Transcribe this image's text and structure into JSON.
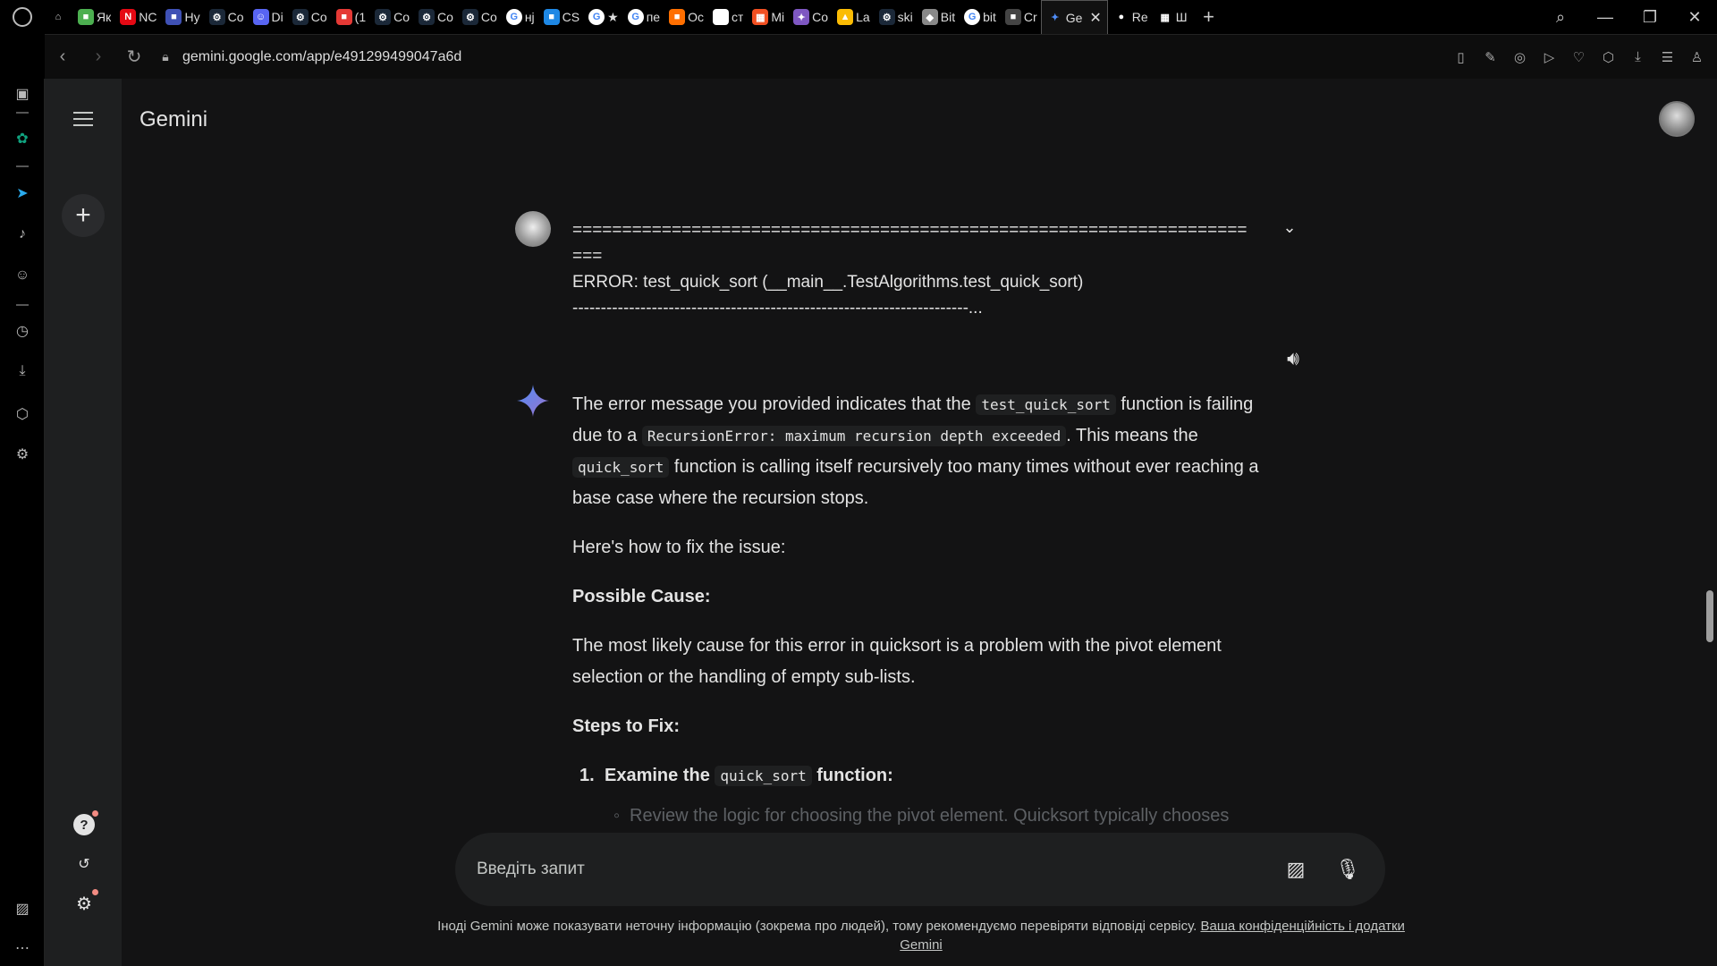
{
  "browser": {
    "tabs": [
      {
        "label": "Як",
        "icon": "app-icon",
        "color": "#4caf50"
      },
      {
        "label": "NC",
        "icon": "netflix-icon",
        "color": "#e50914"
      },
      {
        "label": "Hy",
        "icon": "app-icon",
        "color": "#3f51b5"
      },
      {
        "label": "Co",
        "icon": "steam-icon",
        "color": "#1b2838"
      },
      {
        "label": "Di",
        "icon": "discord-icon",
        "color": "#5865f2"
      },
      {
        "label": "Co",
        "icon": "steam-icon",
        "color": "#1b2838"
      },
      {
        "label": "(1",
        "icon": "app-icon",
        "color": "#e53935"
      },
      {
        "label": "Co",
        "icon": "steam-icon",
        "color": "#1b2838"
      },
      {
        "label": "Co",
        "icon": "steam-icon",
        "color": "#1b2838"
      },
      {
        "label": "Co",
        "icon": "steam-icon",
        "color": "#1b2838"
      },
      {
        "label": "нј",
        "icon": "google-icon",
        "color": "#ffffff"
      },
      {
        "label": "CS",
        "icon": "app-icon",
        "color": "#1e88e5"
      },
      {
        "label": "★",
        "icon": "google-icon",
        "color": "#ffffff"
      },
      {
        "label": "пе",
        "icon": "google-icon",
        "color": "#ffffff"
      },
      {
        "label": "Oc",
        "icon": "app-icon",
        "color": "#ff6f00"
      },
      {
        "label": "ст",
        "icon": "openai-icon",
        "color": "#ffffff"
      },
      {
        "label": "Mi",
        "icon": "microsoft-icon",
        "color": "#f25022"
      },
      {
        "label": "Co",
        "icon": "copilot-icon",
        "color": "#7e57c2"
      },
      {
        "label": "La",
        "icon": "drive-icon",
        "color": "#fbbc04"
      },
      {
        "label": "ski",
        "icon": "steam-icon",
        "color": "#1b2838"
      },
      {
        "label": "Bit",
        "icon": "shield-icon",
        "color": "#888888"
      },
      {
        "label": "bit",
        "icon": "google-icon",
        "color": "#ffffff"
      },
      {
        "label": "Cr",
        "icon": "app-icon",
        "color": "#444444"
      }
    ],
    "active_tab": {
      "label": "Ge",
      "icon": "gemini-icon"
    },
    "after_tabs": [
      {
        "label": "Re",
        "icon": "github-icon"
      },
      {
        "label": "Ш",
        "icon": "grid-icon"
      }
    ],
    "url": "gemini.google.com/app/e491299499047a6d"
  },
  "gemini": {
    "title": "Gemini",
    "user_message": {
      "line1": "====================================================================",
      "line2": "===",
      "line3": "ERROR: test_quick_sort (__main__.TestAlgorithms.test_quick_sort)",
      "line4": "----------------------------------------------------------------------..."
    },
    "response": {
      "p1_a": "The error message you provided indicates that the ",
      "p1_code1": "test_quick_sort",
      "p1_b": " function is failing due to a ",
      "p1_code2": "RecursionError: maximum recursion depth exceeded",
      "p1_c": ". This means the ",
      "p1_code3": "quick_sort",
      "p1_d": " function is calling itself recursively too many times without ever reaching a base case where the recursion stops.",
      "p2": "Here's how to fix the issue:",
      "h1": "Possible Cause:",
      "p3": "The most likely cause for this error in quicksort is a problem with the pivot element selection or the handling of empty sub-lists.",
      "h2": "Steps to Fix:",
      "step1_num": "1.",
      "step1_a": "Examine the ",
      "step1_code": "quick_sort",
      "step1_b": " function:",
      "sub_bullet": "◦",
      "sub1": "Review the logic for choosing the pivot element. Quicksort typically chooses"
    },
    "prompt_placeholder": "Введіть запит",
    "disclaimer_text": "Іноді Gemini може показувати неточну інформацію (зокрема про людей), тому рекомендуємо перевіряти відповіді сервісу. ",
    "disclaimer_link": "Ваша конфіденційність і додатки Gemini"
  }
}
